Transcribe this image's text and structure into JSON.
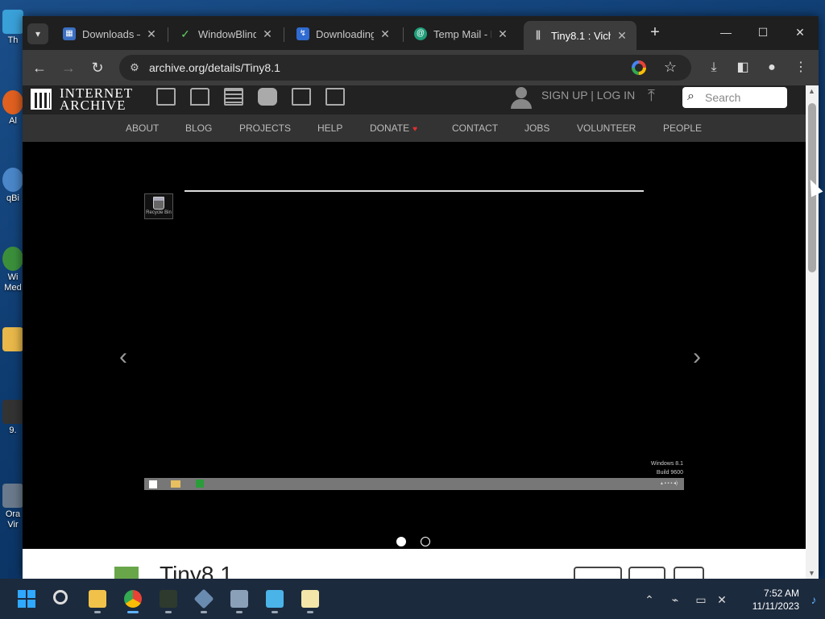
{
  "desktop": {
    "icons": [
      {
        "name": "desktop-icon-1",
        "label": "Th"
      },
      {
        "name": "desktop-icon-2",
        "label": "Al"
      },
      {
        "name": "desktop-icon-3",
        "label": "qBi"
      },
      {
        "name": "desktop-icon-4",
        "label": "Wi Med"
      },
      {
        "name": "desktop-icon-5",
        "label": "9."
      },
      {
        "name": "desktop-icon-6",
        "label": "Ora Vir"
      }
    ]
  },
  "browser": {
    "tabs": [
      {
        "title": "Downloads – ",
        "active": false
      },
      {
        "title": "WindowBlind",
        "active": false
      },
      {
        "title": "Downloading",
        "active": false
      },
      {
        "title": "Temp Mail - D",
        "active": false
      },
      {
        "title": "Tiny8.1 : Vich",
        "active": true
      }
    ],
    "address": "archive.org/details/Tiny8.1",
    "colors": {
      "tabstrip": "#1f1f1f",
      "toolbar": "#3c3c3c",
      "active_tab": "#3c3c3c"
    }
  },
  "ia": {
    "logo_line1": "INTERNET",
    "logo_line2": "ARCHIVE",
    "signup": "SIGN UP | LOG IN",
    "search_placeholder": "Search",
    "nav": [
      "ABOUT",
      "BLOG",
      "PROJECTS",
      "HELP",
      "DONATE",
      "CONTACT",
      "JOBS",
      "VOLUNTEER",
      "PEOPLE"
    ],
    "donate_heart": "♥",
    "recycle_label": "Recycle Bin",
    "watermark_line1": "Windows 8.1",
    "watermark_line2": "Build 9600",
    "carousel_prev": "‹",
    "carousel_next": "›",
    "item_title": "Tiny8.1"
  },
  "taskbar": {
    "time": "7:52 AM",
    "date": "11/11/2023"
  }
}
